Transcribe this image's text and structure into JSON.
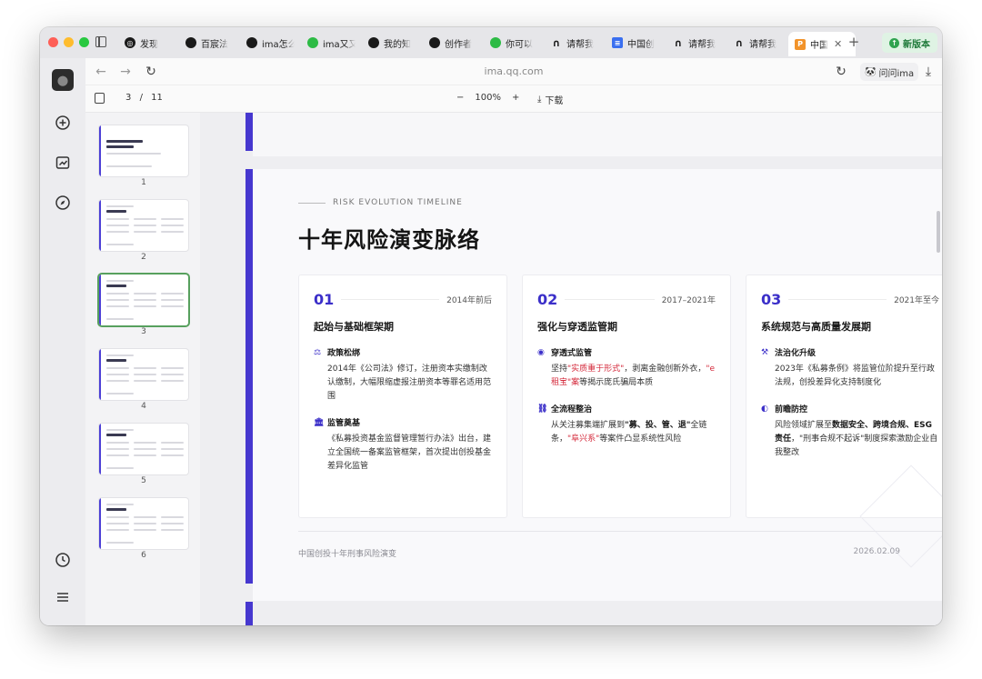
{
  "browser": {
    "tabs": [
      {
        "label": "发现",
        "icon": "compass-icon",
        "color": "#1a1a1a"
      },
      {
        "label": "百宸法",
        "icon": "ima-icon",
        "color": "#1a1a1a"
      },
      {
        "label": "ima怎么",
        "icon": "ima-icon",
        "color": "#1a1a1a"
      },
      {
        "label": "ima又又",
        "icon": "wechat-icon",
        "color": "#2dbb45"
      },
      {
        "label": "我的知",
        "icon": "ima-knowledge-icon",
        "color": "#1a1a1a"
      },
      {
        "label": "创作者",
        "icon": "ima-knowledge-icon",
        "color": "#1a1a1a"
      },
      {
        "label": "你可以",
        "icon": "wechat-icon",
        "color": "#2dbb45"
      },
      {
        "label": "请帮我",
        "icon": "ai-logo-icon",
        "color": "#1a1a1a"
      },
      {
        "label": "中国创",
        "icon": "doc-icon",
        "color": "#3a6ff0"
      },
      {
        "label": "请帮我",
        "icon": "ai-logo-icon",
        "color": "#1a1a1a"
      },
      {
        "label": "请帮我",
        "icon": "ai-logo-icon",
        "color": "#1a1a1a"
      },
      {
        "label": "中国",
        "icon": "ppt-icon",
        "color": "#f2932a"
      }
    ],
    "active_tab_index": 11,
    "new_version_label": "新版本",
    "url": "ima.qq.com",
    "ask_label": "问问ima"
  },
  "toolbar": {
    "current_page": "3",
    "separator": "/",
    "total_pages": "11",
    "zoom": "100%",
    "zoom_out": "−",
    "zoom_in": "+",
    "download_label": "下载"
  },
  "thumbnails": [
    "1",
    "2",
    "3",
    "4",
    "5",
    "6"
  ],
  "selected_thumbnail": 3,
  "slide": {
    "kicker": "RISK EVOLUTION TIMELINE",
    "title": "十年风险演变脉络",
    "cards": [
      {
        "num": "01",
        "period": "2014年前后",
        "title": "起始与基础框架期",
        "items": [
          {
            "icon": "balance-scale-icon",
            "glyph": "⚖",
            "title": "政策松绑",
            "desc": [
              {
                "t": "2014年《公司法》修订，注册资本实缴制改认缴制，大幅限缩虚报注册资本等罪名适用范围",
                "s": ""
              }
            ]
          },
          {
            "icon": "institution-icon",
            "glyph": "🏛",
            "title": "监管奠基",
            "desc": [
              {
                "t": "《私募投资基金监督管理暂行办法》出台，建立全国统一备案监管框架，首次提出创投基金差异化监管",
                "s": ""
              }
            ]
          }
        ]
      },
      {
        "num": "02",
        "period": "2017–2021年",
        "title": "强化与穿透监管期",
        "items": [
          {
            "icon": "eye-icon",
            "glyph": "◉",
            "title": "穿透式监管",
            "desc": [
              {
                "t": "坚持",
                "s": ""
              },
              {
                "t": "\"实质重于形式\"",
                "s": "red"
              },
              {
                "t": "，剥离金融创新外衣，",
                "s": ""
              },
              {
                "t": "\"e租宝\"案",
                "s": "red"
              },
              {
                "t": "等揭示庞氏骗局本质",
                "s": ""
              }
            ]
          },
          {
            "icon": "link-icon",
            "glyph": "⛓",
            "title": "全流程整治",
            "desc": [
              {
                "t": "从关注募集端扩展到",
                "s": ""
              },
              {
                "t": "\"募、投、管、退\"",
                "s": "bld"
              },
              {
                "t": "全链条，",
                "s": ""
              },
              {
                "t": "\"阜兴系\"",
                "s": "red"
              },
              {
                "t": "等案件凸显系统性风险",
                "s": ""
              }
            ]
          }
        ]
      },
      {
        "num": "03",
        "period": "2021年至今",
        "title": "系统规范与高质量发展期",
        "items": [
          {
            "icon": "gavel-icon",
            "glyph": "⚒",
            "title": "法治化升级",
            "desc": [
              {
                "t": "2023年《私募条例》将监管位阶提升至行政法规，创投差异化支持制度化",
                "s": ""
              }
            ]
          },
          {
            "icon": "shield-icon",
            "glyph": "◐",
            "title": "前瞻防控",
            "desc": [
              {
                "t": "风险领域扩展至",
                "s": ""
              },
              {
                "t": "数据安全、跨境合规、ESG责任",
                "s": "bld"
              },
              {
                "t": "，\"刑事合规不起诉\"制度探索激励企业自我整改",
                "s": ""
              }
            ]
          }
        ]
      }
    ],
    "footer_left": "中国创投十年刑事风险演变",
    "footer_right": "2026.02.09"
  },
  "colors": {
    "accent": "#3b2fc9",
    "highlight_red": "#d4283a",
    "selected_thumb": "#57a05e"
  }
}
